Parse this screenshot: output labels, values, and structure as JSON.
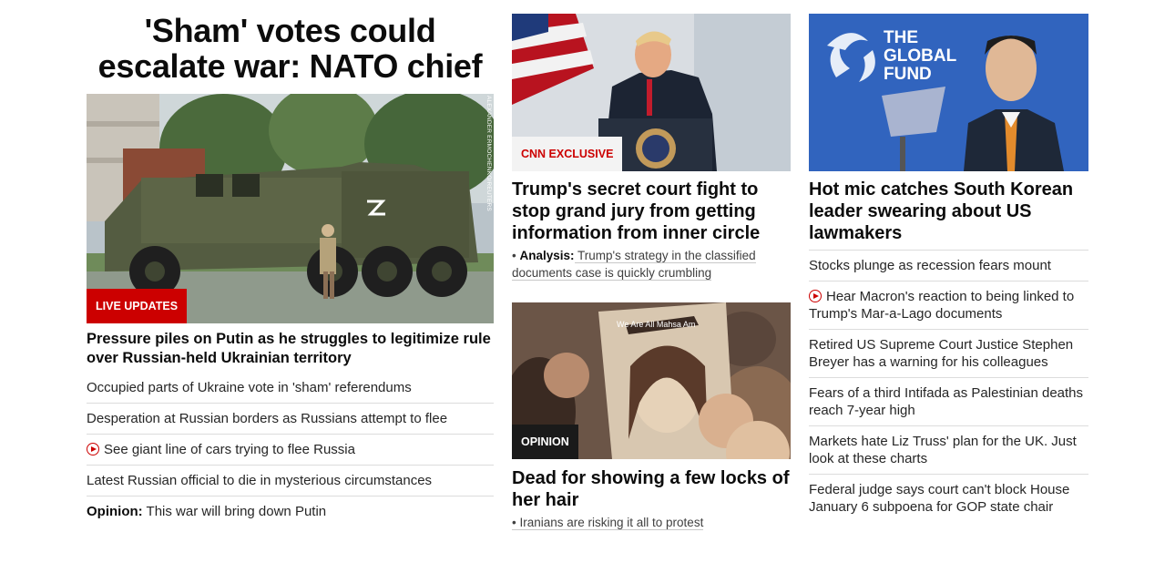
{
  "lead": {
    "banner_headline": "'Sham' votes could escalate war: NATO chief",
    "image_credit": "ALEXANDER ERMOCHENKO/REUTERS",
    "image_label": "LIVE UPDATES",
    "headline": "Pressure piles on Putin as he struggles to legitimize rule over Russian-held Ukrainian territory",
    "links": [
      {
        "prefix": "",
        "text": "Occupied parts of Ukraine vote in 'sham' referendums",
        "video": false
      },
      {
        "prefix": "",
        "text": "Desperation at Russian borders as Russians attempt to flee",
        "video": false
      },
      {
        "prefix": "",
        "text": "See giant line of cars trying to flee Russia",
        "video": true
      },
      {
        "prefix": "",
        "text": "Latest Russian official to die in mysterious circumstances",
        "video": false
      },
      {
        "prefix": "Opinion:",
        "text": " This war will bring down Putin",
        "video": false
      }
    ]
  },
  "middle": {
    "story1": {
      "image_label": "CNN EXCLUSIVE",
      "headline": "Trump's secret court fight to stop grand jury from getting information from inner circle",
      "sub_bullet": "• ",
      "sub_prefix": "Analysis:",
      "sub_text": " Trump's strategy in the classified documents case is quickly crumbling"
    },
    "story2": {
      "image_label": "OPINION",
      "sign_text": "We Are All Mahsa Am",
      "headline": "Dead for showing a few locks of her hair",
      "sub_text": "• Iranians are risking it all to protest"
    }
  },
  "right": {
    "logo_line1": "THE",
    "logo_line2": "GLOBAL",
    "logo_line3": "FUND",
    "headline": "Hot mic catches South Korean leader swearing about US lawmakers",
    "links": [
      {
        "text": "Stocks plunge as recession fears mount",
        "video": false
      },
      {
        "text": "Hear Macron's reaction to being linked to Trump's Mar-a-Lago documents",
        "video": true
      },
      {
        "text": "Retired US Supreme Court Justice Stephen Breyer has a warning for his colleagues",
        "video": false
      },
      {
        "text": "Fears of a third Intifada as Palestinian deaths reach 7-year high",
        "video": false
      },
      {
        "text": "Markets hate Liz Truss' plan for the UK. Just look at these charts",
        "video": false
      },
      {
        "text": "Federal judge says court can't block House January 6 subpoena for GOP state chair",
        "video": false
      }
    ]
  },
  "colors": {
    "accent": "#cc0000",
    "text": "#0c0c0c",
    "divider": "#dcdcdc"
  }
}
